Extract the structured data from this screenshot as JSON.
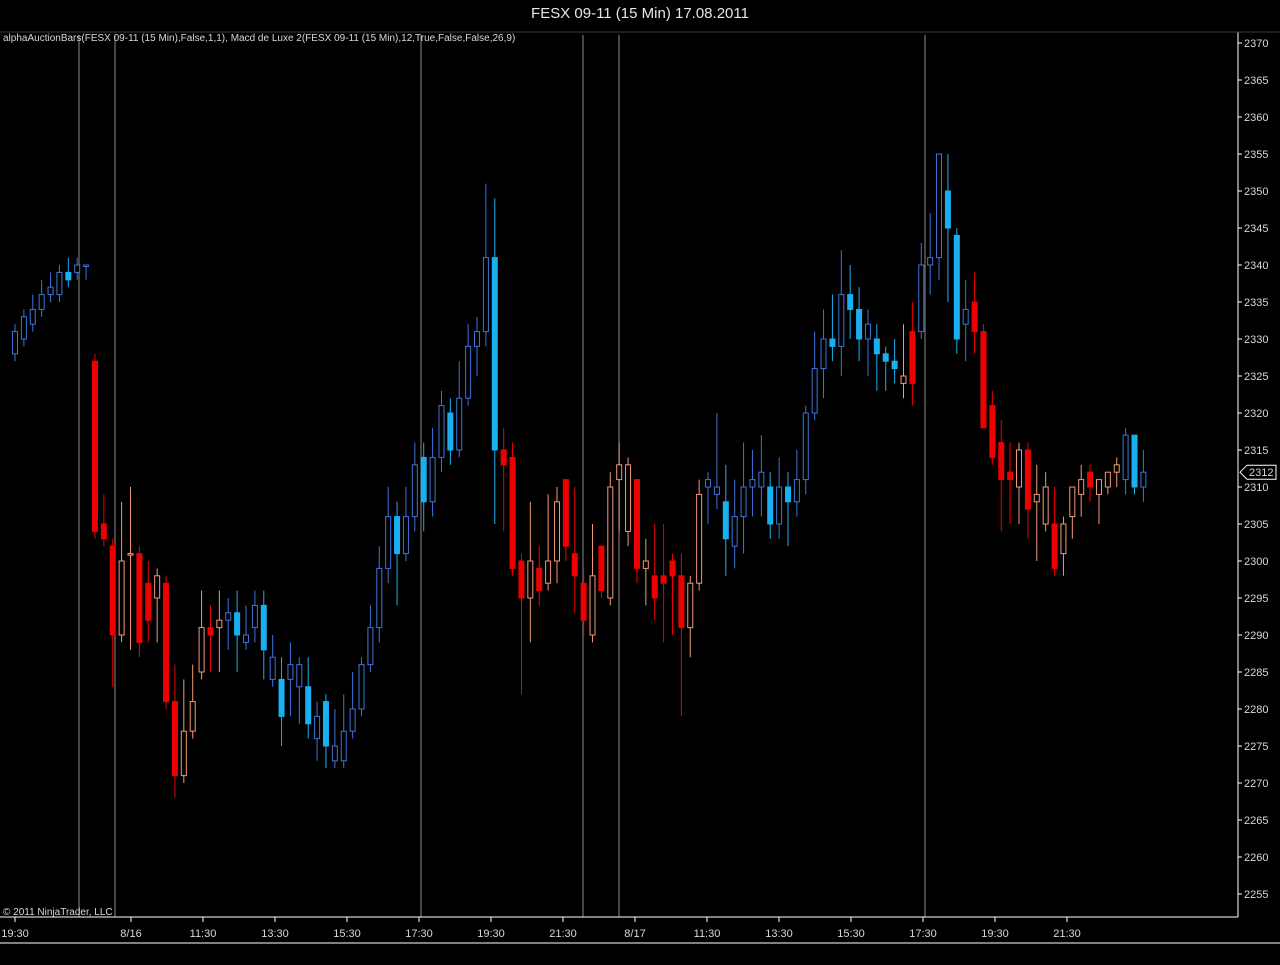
{
  "window": {
    "title": "FESX 09-11 (15 Min)  17.08.2011"
  },
  "indicator_label": "alphaAuctionBars(FESX 09-11 (15 Min),False,1,1), Macd de Luxe 2(FESX 09-11 (15 Min),12,True,False,False,26,9)",
  "copyright": "© 2011 NinjaTrader, LLC",
  "price_marker": "2312",
  "colors": {
    "background": "#000000",
    "strong_up": "#1ab0ef",
    "weak_up": "#3e74d8",
    "strong_down": "#ee0000",
    "weak_down": "#f29a76",
    "axis": "#ffffff",
    "session_line": "#8a8a8a"
  },
  "chart_data": {
    "type": "candlestick",
    "instrument": "FESX 09-11",
    "timeframe": "15 Min",
    "ylim": [
      2252,
      2371
    ],
    "y_ticks": [
      2255,
      2260,
      2265,
      2270,
      2275,
      2280,
      2285,
      2290,
      2295,
      2300,
      2305,
      2310,
      2315,
      2320,
      2325,
      2330,
      2335,
      2340,
      2345,
      2350,
      2355,
      2360,
      2365,
      2370
    ],
    "x_tick_labels": [
      "19:30",
      "8/16",
      "11:30",
      "13:30",
      "15:30",
      "17:30",
      "19:30",
      "21:30",
      "8/17",
      "11:30",
      "13:30",
      "15:30",
      "17:30",
      "19:30",
      "21:30"
    ],
    "last_price": 2312,
    "bars": [
      {
        "o": 2328,
        "h": 2332,
        "l": 2327,
        "c": 2331,
        "s": "up"
      },
      {
        "o": 2330,
        "h": 2334,
        "l": 2329,
        "c": 2333,
        "s": "up"
      },
      {
        "o": 2332,
        "h": 2336,
        "l": 2331,
        "c": 2334,
        "s": "up"
      },
      {
        "o": 2334,
        "h": 2338,
        "l": 2333,
        "c": 2336,
        "s": "up"
      },
      {
        "o": 2336,
        "h": 2339,
        "l": 2335,
        "c": 2337,
        "s": "up"
      },
      {
        "o": 2336,
        "h": 2340,
        "l": 2335,
        "c": 2339,
        "s": "up"
      },
      {
        "o": 2338,
        "h": 2341,
        "l": 2337,
        "c": 2339,
        "s": "UP"
      },
      {
        "o": 2339,
        "h": 2341,
        "l": 2338,
        "c": 2340,
        "s": "up"
      },
      {
        "o": 2340,
        "h": 2340,
        "l": 2338,
        "c": 2340,
        "s": "up"
      },
      {
        "o": 2327,
        "h": 2328,
        "l": 2303,
        "c": 2304,
        "s": "DN"
      },
      {
        "o": 2305,
        "h": 2309,
        "l": 2302,
        "c": 2303,
        "s": "DN"
      },
      {
        "o": 2302,
        "h": 2303,
        "l": 2283,
        "c": 2290,
        "s": "DN"
      },
      {
        "o": 2300,
        "h": 2308,
        "l": 2289,
        "c": 2290,
        "s": "dn"
      },
      {
        "o": 2301,
        "h": 2310,
        "l": 2288,
        "c": 2301,
        "s": "dn"
      },
      {
        "o": 2301,
        "h": 2302,
        "l": 2287,
        "c": 2289,
        "s": "DN"
      },
      {
        "o": 2297,
        "h": 2300,
        "l": 2289,
        "c": 2292,
        "s": "DN"
      },
      {
        "o": 2295,
        "h": 2299,
        "l": 2289,
        "c": 2298,
        "s": "dn"
      },
      {
        "o": 2297,
        "h": 2298,
        "l": 2280,
        "c": 2281,
        "s": "DN"
      },
      {
        "o": 2281,
        "h": 2286,
        "l": 2268,
        "c": 2271,
        "s": "DN"
      },
      {
        "o": 2271,
        "h": 2284,
        "l": 2270,
        "c": 2277,
        "s": "dn"
      },
      {
        "o": 2277,
        "h": 2286,
        "l": 2276,
        "c": 2281,
        "s": "dn"
      },
      {
        "o": 2285,
        "h": 2296,
        "l": 2284,
        "c": 2291,
        "s": "dn"
      },
      {
        "o": 2291,
        "h": 2294,
        "l": 2285,
        "c": 2290,
        "s": "DN"
      },
      {
        "o": 2291,
        "h": 2296,
        "l": 2285,
        "c": 2292,
        "s": "dn"
      },
      {
        "o": 2292,
        "h": 2295,
        "l": 2288,
        "c": 2293,
        "s": "up"
      },
      {
        "o": 2293,
        "h": 2296,
        "l": 2285,
        "c": 2290,
        "s": "UP"
      },
      {
        "o": 2289,
        "h": 2294,
        "l": 2288,
        "c": 2290,
        "s": "up"
      },
      {
        "o": 2291,
        "h": 2296,
        "l": 2289,
        "c": 2294,
        "s": "up"
      },
      {
        "o": 2294,
        "h": 2296,
        "l": 2284,
        "c": 2288,
        "s": "UP"
      },
      {
        "o": 2287,
        "h": 2290,
        "l": 2283,
        "c": 2284,
        "s": "up"
      },
      {
        "o": 2284,
        "h": 2287,
        "l": 2275,
        "c": 2279,
        "s": "UP"
      },
      {
        "o": 2284,
        "h": 2289,
        "l": 2279,
        "c": 2286,
        "s": "up"
      },
      {
        "o": 2286,
        "h": 2287,
        "l": 2278,
        "c": 2283,
        "s": "up"
      },
      {
        "o": 2283,
        "h": 2287,
        "l": 2276,
        "c": 2278,
        "s": "UP"
      },
      {
        "o": 2279,
        "h": 2281,
        "l": 2273,
        "c": 2276,
        "s": "up"
      },
      {
        "o": 2281,
        "h": 2282,
        "l": 2272,
        "c": 2275,
        "s": "UP"
      },
      {
        "o": 2275,
        "h": 2280,
        "l": 2272,
        "c": 2273,
        "s": "up"
      },
      {
        "o": 2273,
        "h": 2282,
        "l": 2272,
        "c": 2277,
        "s": "up"
      },
      {
        "o": 2277,
        "h": 2285,
        "l": 2276,
        "c": 2280,
        "s": "up"
      },
      {
        "o": 2280,
        "h": 2287,
        "l": 2279,
        "c": 2286,
        "s": "up"
      },
      {
        "o": 2286,
        "h": 2294,
        "l": 2285,
        "c": 2291,
        "s": "up"
      },
      {
        "o": 2291,
        "h": 2302,
        "l": 2289,
        "c": 2299,
        "s": "up"
      },
      {
        "o": 2299,
        "h": 2310,
        "l": 2297,
        "c": 2306,
        "s": "up"
      },
      {
        "o": 2306,
        "h": 2308,
        "l": 2294,
        "c": 2301,
        "s": "UP"
      },
      {
        "o": 2301,
        "h": 2310,
        "l": 2300,
        "c": 2306,
        "s": "up"
      },
      {
        "o": 2306,
        "h": 2316,
        "l": 2304,
        "c": 2313,
        "s": "up"
      },
      {
        "o": 2314,
        "h": 2316,
        "l": 2304,
        "c": 2308,
        "s": "UP"
      },
      {
        "o": 2308,
        "h": 2318,
        "l": 2306,
        "c": 2314,
        "s": "up"
      },
      {
        "o": 2314,
        "h": 2323,
        "l": 2312,
        "c": 2321,
        "s": "up"
      },
      {
        "o": 2320,
        "h": 2322,
        "l": 2313,
        "c": 2315,
        "s": "UP"
      },
      {
        "o": 2315,
        "h": 2327,
        "l": 2314,
        "c": 2322,
        "s": "up"
      },
      {
        "o": 2322,
        "h": 2332,
        "l": 2321,
        "c": 2329,
        "s": "up"
      },
      {
        "o": 2329,
        "h": 2333,
        "l": 2325,
        "c": 2331,
        "s": "up"
      },
      {
        "o": 2331,
        "h": 2351,
        "l": 2329,
        "c": 2341,
        "s": "up"
      },
      {
        "o": 2341,
        "h": 2349,
        "l": 2305,
        "c": 2315,
        "s": "UP"
      },
      {
        "o": 2315,
        "h": 2318,
        "l": 2304,
        "c": 2313,
        "s": "DN"
      },
      {
        "o": 2314,
        "h": 2316,
        "l": 2298,
        "c": 2299,
        "s": "DN"
      },
      {
        "o": 2300,
        "h": 2301,
        "l": 2282,
        "c": 2295,
        "s": "DN"
      },
      {
        "o": 2300,
        "h": 2308,
        "l": 2289,
        "c": 2295,
        "s": "dn"
      },
      {
        "o": 2299,
        "h": 2302,
        "l": 2294,
        "c": 2296,
        "s": "DN"
      },
      {
        "o": 2297,
        "h": 2309,
        "l": 2296,
        "c": 2300,
        "s": "dn"
      },
      {
        "o": 2300,
        "h": 2310,
        "l": 2297,
        "c": 2308,
        "s": "dn"
      },
      {
        "o": 2311,
        "h": 2311,
        "l": 2300,
        "c": 2302,
        "s": "DN"
      },
      {
        "o": 2301,
        "h": 2310,
        "l": 2293,
        "c": 2298,
        "s": "DN"
      },
      {
        "o": 2297,
        "h": 2299,
        "l": 2290,
        "c": 2292,
        "s": "DN"
      },
      {
        "o": 2290,
        "h": 2305,
        "l": 2289,
        "c": 2298,
        "s": "dn"
      },
      {
        "o": 2302,
        "h": 2302,
        "l": 2295,
        "c": 2296,
        "s": "DN"
      },
      {
        "o": 2295,
        "h": 2312,
        "l": 2294,
        "c": 2310,
        "s": "dn"
      },
      {
        "o": 2311,
        "h": 2316,
        "l": 2304,
        "c": 2313,
        "s": "dn"
      },
      {
        "o": 2313,
        "h": 2314,
        "l": 2302,
        "c": 2304,
        "s": "dn"
      },
      {
        "o": 2311,
        "h": 2311,
        "l": 2297,
        "c": 2299,
        "s": "DN"
      },
      {
        "o": 2299,
        "h": 2303,
        "l": 2294,
        "c": 2300,
        "s": "dn"
      },
      {
        "o": 2298,
        "h": 2305,
        "l": 2292,
        "c": 2295,
        "s": "DN"
      },
      {
        "o": 2297,
        "h": 2305,
        "l": 2289,
        "c": 2298,
        "s": "DN"
      },
      {
        "o": 2300,
        "h": 2301,
        "l": 2290,
        "c": 2298,
        "s": "DN"
      },
      {
        "o": 2298,
        "h": 2301,
        "l": 2279,
        "c": 2291,
        "s": "DN"
      },
      {
        "o": 2291,
        "h": 2298,
        "l": 2287,
        "c": 2297,
        "s": "dn"
      },
      {
        "o": 2297,
        "h": 2311,
        "l": 2296,
        "c": 2309,
        "s": "dn"
      },
      {
        "o": 2310,
        "h": 2312,
        "l": 2305,
        "c": 2311,
        "s": "up"
      },
      {
        "o": 2310,
        "h": 2320,
        "l": 2307,
        "c": 2309,
        "s": "up"
      },
      {
        "o": 2308,
        "h": 2313,
        "l": 2298,
        "c": 2303,
        "s": "UP"
      },
      {
        "o": 2302,
        "h": 2311,
        "l": 2299,
        "c": 2306,
        "s": "up"
      },
      {
        "o": 2306,
        "h": 2316,
        "l": 2301,
        "c": 2310,
        "s": "up"
      },
      {
        "o": 2310,
        "h": 2315,
        "l": 2306,
        "c": 2311,
        "s": "up"
      },
      {
        "o": 2310,
        "h": 2317,
        "l": 2306,
        "c": 2312,
        "s": "up"
      },
      {
        "o": 2310,
        "h": 2312,
        "l": 2303,
        "c": 2305,
        "s": "UP"
      },
      {
        "o": 2305,
        "h": 2314,
        "l": 2303,
        "c": 2310,
        "s": "up"
      },
      {
        "o": 2310,
        "h": 2312,
        "l": 2302,
        "c": 2308,
        "s": "UP"
      },
      {
        "o": 2308,
        "h": 2315,
        "l": 2306,
        "c": 2311,
        "s": "up"
      },
      {
        "o": 2311,
        "h": 2321,
        "l": 2309,
        "c": 2320,
        "s": "up"
      },
      {
        "o": 2320,
        "h": 2331,
        "l": 2319,
        "c": 2326,
        "s": "up"
      },
      {
        "o": 2326,
        "h": 2334,
        "l": 2322,
        "c": 2330,
        "s": "up"
      },
      {
        "o": 2330,
        "h": 2336,
        "l": 2327,
        "c": 2329,
        "s": "UP"
      },
      {
        "o": 2329,
        "h": 2342,
        "l": 2325,
        "c": 2336,
        "s": "up"
      },
      {
        "o": 2336,
        "h": 2340,
        "l": 2330,
        "c": 2334,
        "s": "UP"
      },
      {
        "o": 2334,
        "h": 2337,
        "l": 2327,
        "c": 2330,
        "s": "UP"
      },
      {
        "o": 2330,
        "h": 2334,
        "l": 2325,
        "c": 2332,
        "s": "up"
      },
      {
        "o": 2330,
        "h": 2332,
        "l": 2323,
        "c": 2328,
        "s": "UP"
      },
      {
        "o": 2328,
        "h": 2329,
        "l": 2323,
        "c": 2327,
        "s": "UP"
      },
      {
        "o": 2327,
        "h": 2330,
        "l": 2324,
        "c": 2326,
        "s": "UP"
      },
      {
        "o": 2325,
        "h": 2332,
        "l": 2322,
        "c": 2324,
        "s": "dn"
      },
      {
        "o": 2324,
        "h": 2335,
        "l": 2321,
        "c": 2331,
        "s": "DN"
      },
      {
        "o": 2331,
        "h": 2343,
        "l": 2330,
        "c": 2340,
        "s": "up"
      },
      {
        "o": 2340,
        "h": 2347,
        "l": 2336,
        "c": 2341,
        "s": "up"
      },
      {
        "o": 2341,
        "h": 2355,
        "l": 2338,
        "c": 2355,
        "s": "up"
      },
      {
        "o": 2345,
        "h": 2355,
        "l": 2335,
        "c": 2350,
        "s": "UP"
      },
      {
        "o": 2344,
        "h": 2345,
        "l": 2328,
        "c": 2330,
        "s": "UP"
      },
      {
        "o": 2334,
        "h": 2338,
        "l": 2327,
        "c": 2332,
        "s": "up"
      },
      {
        "o": 2335,
        "h": 2339,
        "l": 2328,
        "c": 2331,
        "s": "DN"
      },
      {
        "o": 2331,
        "h": 2332,
        "l": 2318,
        "c": 2318,
        "s": "DN"
      },
      {
        "o": 2321,
        "h": 2323,
        "l": 2313,
        "c": 2314,
        "s": "DN"
      },
      {
        "o": 2316,
        "h": 2319,
        "l": 2304,
        "c": 2311,
        "s": "DN"
      },
      {
        "o": 2312,
        "h": 2316,
        "l": 2305,
        "c": 2311,
        "s": "DN"
      },
      {
        "o": 2315,
        "h": 2316,
        "l": 2305,
        "c": 2310,
        "s": "dn"
      },
      {
        "o": 2315,
        "h": 2316,
        "l": 2303,
        "c": 2307,
        "s": "DN"
      },
      {
        "o": 2308,
        "h": 2313,
        "l": 2300,
        "c": 2309,
        "s": "dn"
      },
      {
        "o": 2310,
        "h": 2312,
        "l": 2304,
        "c": 2305,
        "s": "dn"
      },
      {
        "o": 2305,
        "h": 2310,
        "l": 2298,
        "c": 2299,
        "s": "DN"
      },
      {
        "o": 2301,
        "h": 2306,
        "l": 2298,
        "c": 2305,
        "s": "dn"
      },
      {
        "o": 2306,
        "h": 2309,
        "l": 2303,
        "c": 2310,
        "s": "dn"
      },
      {
        "o": 2309,
        "h": 2313,
        "l": 2306,
        "c": 2311,
        "s": "dn"
      },
      {
        "o": 2312,
        "h": 2313,
        "l": 2308,
        "c": 2310,
        "s": "DN"
      },
      {
        "o": 2309,
        "h": 2311,
        "l": 2305,
        "c": 2311,
        "s": "dn"
      },
      {
        "o": 2310,
        "h": 2312,
        "l": 2309,
        "c": 2312,
        "s": "dn"
      },
      {
        "o": 2312,
        "h": 2314,
        "l": 2310,
        "c": 2313,
        "s": "dn"
      },
      {
        "o": 2311,
        "h": 2318,
        "l": 2309,
        "c": 2317,
        "s": "up"
      },
      {
        "o": 2317,
        "h": 2317,
        "l": 2309,
        "c": 2310,
        "s": "UP"
      },
      {
        "o": 2310,
        "h": 2315,
        "l": 2308,
        "c": 2312,
        "s": "up"
      }
    ]
  }
}
